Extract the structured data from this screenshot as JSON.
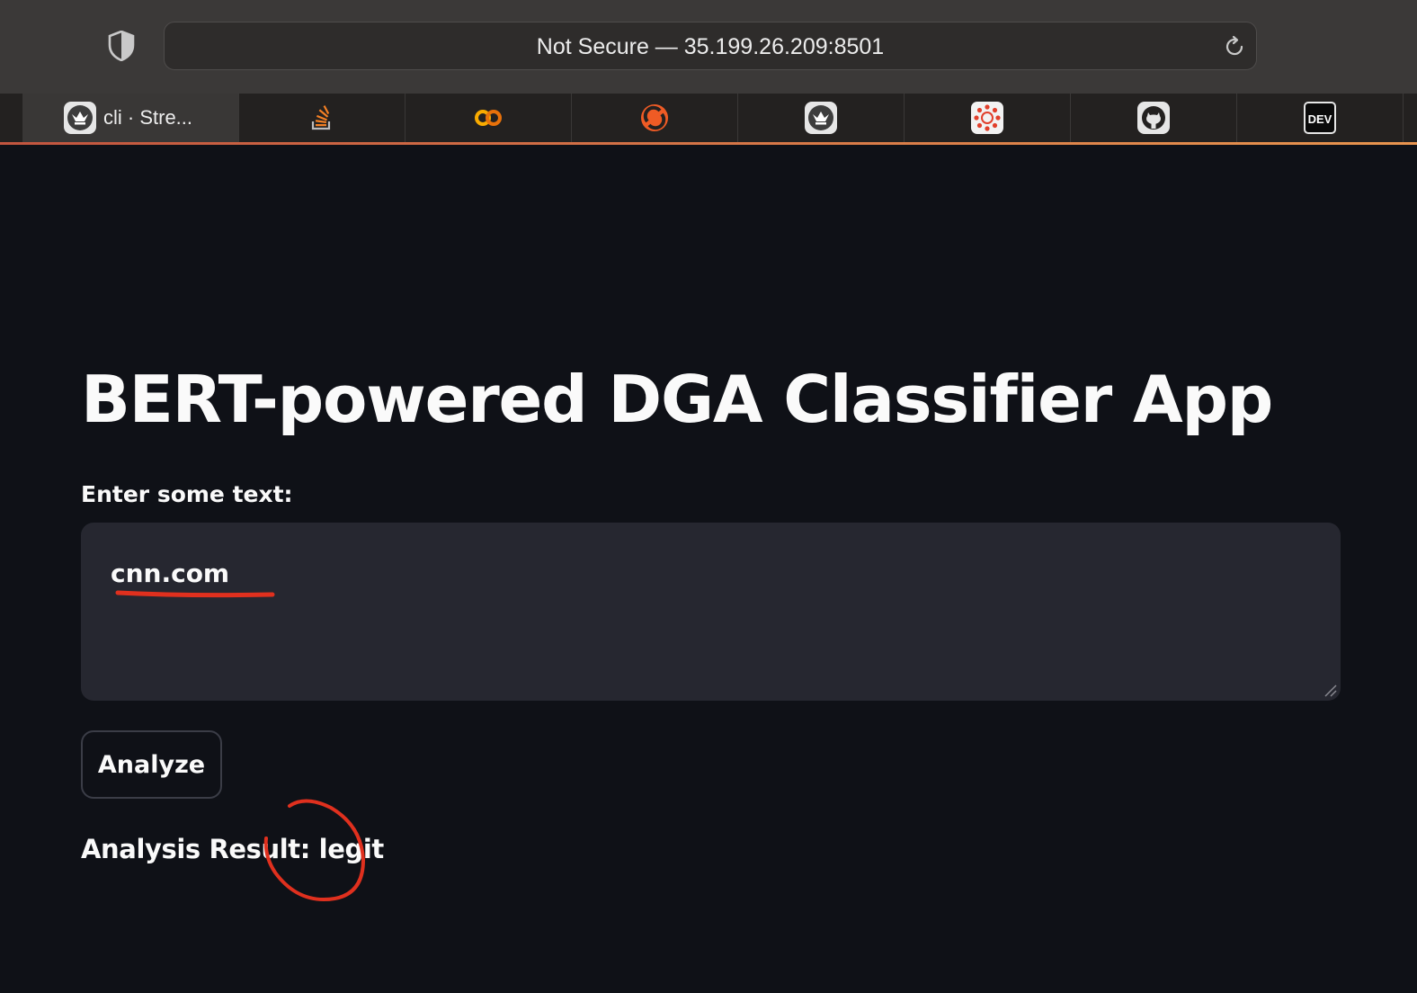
{
  "browser": {
    "url_text": "Not Secure — 35.199.26.209:8501",
    "tabs": [
      {
        "title": "cli · Stre...",
        "icon": "streamlit-icon",
        "active": true
      },
      {
        "title": "",
        "icon": "stackoverflow-icon"
      },
      {
        "title": "",
        "icon": "colab-icon"
      },
      {
        "title": "",
        "icon": "postman-icon"
      },
      {
        "title": "",
        "icon": "streamlit-icon"
      },
      {
        "title": "",
        "icon": "canvas-icon"
      },
      {
        "title": "",
        "icon": "github-icon"
      },
      {
        "title": "",
        "icon": "dev-icon"
      }
    ],
    "dev_icon_text": "DEV",
    "accent_line_colors": [
      "#c2553f",
      "#e8954f"
    ]
  },
  "app": {
    "title": "BERT-powered DGA Classifier App",
    "input_label": "Enter some text:",
    "input_value": "cnn.com",
    "button_label": "Analyze",
    "result_text": "Analysis Result: legit",
    "background_color": "#0f1117",
    "input_background": "#262730"
  },
  "annotations": {
    "color": "#e0301e",
    "items": [
      "underline-input-value",
      "circle-result"
    ]
  }
}
